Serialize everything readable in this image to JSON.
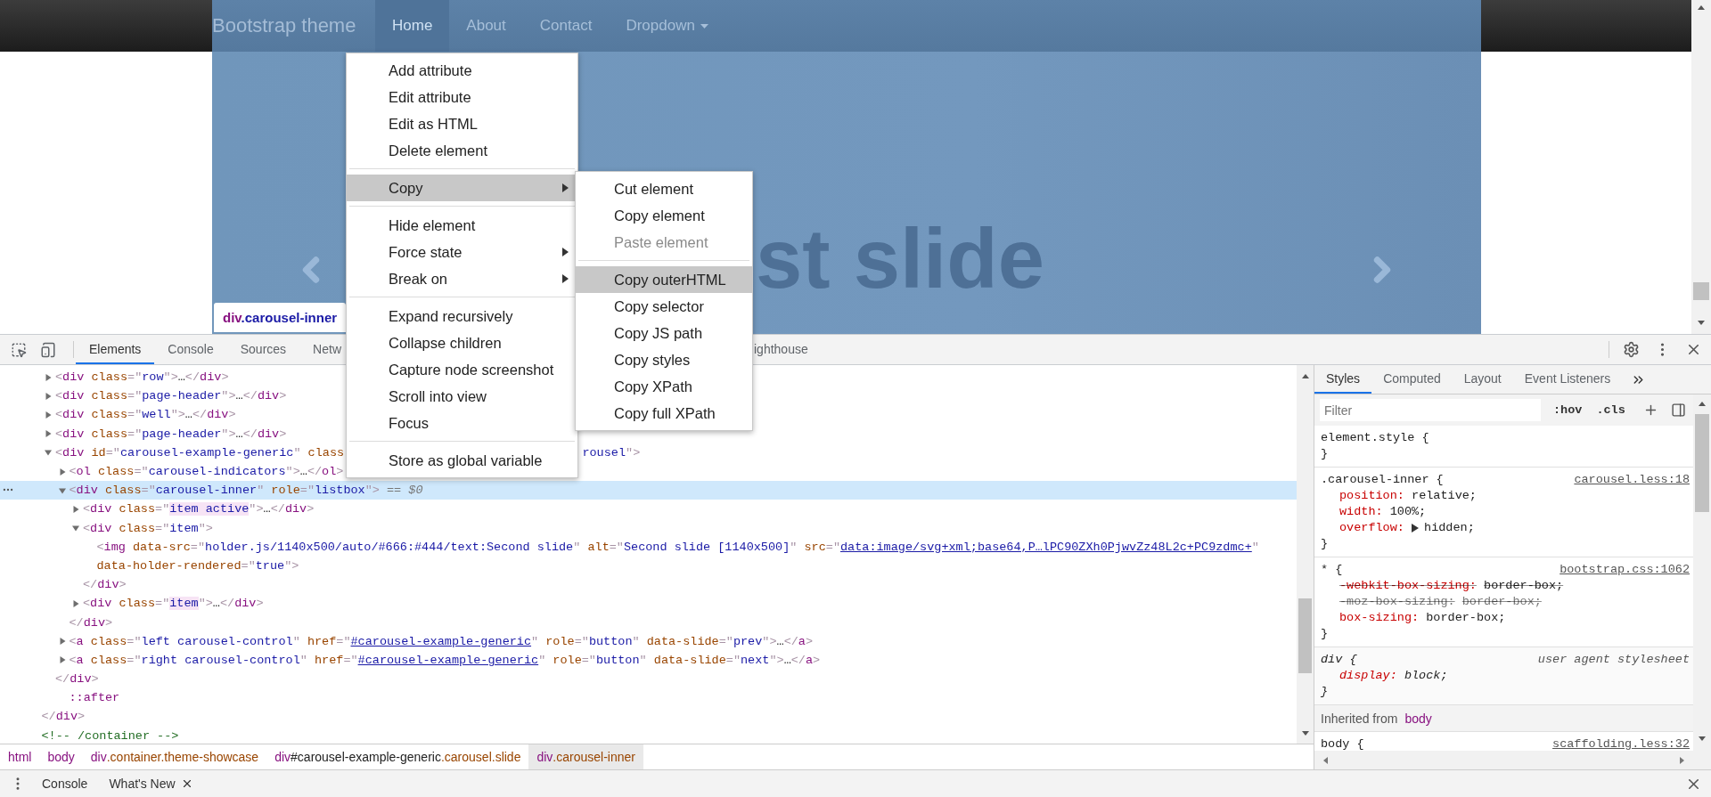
{
  "page": {
    "brand": "Bootstrap theme",
    "nav": [
      {
        "label": "Home",
        "selected": true,
        "dropdown": false
      },
      {
        "label": "About",
        "selected": false,
        "dropdown": false
      },
      {
        "label": "Contact",
        "selected": false,
        "dropdown": false
      },
      {
        "label": "Dropdown",
        "selected": false,
        "dropdown": true
      }
    ],
    "slide_caption": "st slide",
    "inspect_tooltip": {
      "tag": "div",
      "class_name": ".carousel-inner"
    }
  },
  "context_menu": {
    "groups": [
      [
        {
          "label": "Add attribute",
          "highlighted": false,
          "submenu": false,
          "disabled": false
        },
        {
          "label": "Edit attribute",
          "highlighted": false,
          "submenu": false,
          "disabled": false
        },
        {
          "label": "Edit as HTML",
          "highlighted": false,
          "submenu": false,
          "disabled": false
        },
        {
          "label": "Delete element",
          "highlighted": false,
          "submenu": false,
          "disabled": false
        }
      ],
      [
        {
          "label": "Copy",
          "highlighted": true,
          "submenu": true,
          "disabled": false
        }
      ],
      [
        {
          "label": "Hide element",
          "highlighted": false,
          "submenu": false,
          "disabled": false
        },
        {
          "label": "Force state",
          "highlighted": false,
          "submenu": true,
          "disabled": false
        },
        {
          "label": "Break on",
          "highlighted": false,
          "submenu": true,
          "disabled": false
        }
      ],
      [
        {
          "label": "Expand recursively",
          "highlighted": false,
          "submenu": false,
          "disabled": false
        },
        {
          "label": "Collapse children",
          "highlighted": false,
          "submenu": false,
          "disabled": false
        },
        {
          "label": "Capture node screenshot",
          "highlighted": false,
          "submenu": false,
          "disabled": false
        },
        {
          "label": "Scroll into view",
          "highlighted": false,
          "submenu": false,
          "disabled": false
        },
        {
          "label": "Focus",
          "highlighted": false,
          "submenu": false,
          "disabled": false
        }
      ],
      [
        {
          "label": "Store as global variable",
          "highlighted": false,
          "submenu": false,
          "disabled": false
        }
      ]
    ]
  },
  "submenu": {
    "groups": [
      [
        {
          "label": "Cut element",
          "highlighted": false,
          "submenu": false,
          "disabled": false
        },
        {
          "label": "Copy element",
          "highlighted": false,
          "submenu": false,
          "disabled": false
        },
        {
          "label": "Paste element",
          "highlighted": false,
          "submenu": false,
          "disabled": true
        }
      ],
      [
        {
          "label": "Copy outerHTML",
          "highlighted": true,
          "submenu": false,
          "disabled": false
        },
        {
          "label": "Copy selector",
          "highlighted": false,
          "submenu": false,
          "disabled": false
        },
        {
          "label": "Copy JS path",
          "highlighted": false,
          "submenu": false,
          "disabled": false
        },
        {
          "label": "Copy styles",
          "highlighted": false,
          "submenu": false,
          "disabled": false
        },
        {
          "label": "Copy XPath",
          "highlighted": false,
          "submenu": false,
          "disabled": false
        },
        {
          "label": "Copy full XPath",
          "highlighted": false,
          "submenu": false,
          "disabled": false
        }
      ]
    ]
  },
  "devtools": {
    "tabs": [
      {
        "label": "Elements",
        "selected": true
      },
      {
        "label": "Console",
        "selected": false
      },
      {
        "label": "Sources",
        "selected": false
      },
      {
        "label": "Netw",
        "selected": false
      },
      {
        "label": "ighthouse",
        "selected": false
      }
    ],
    "dom_tree": [
      {
        "kind": "expandable",
        "expanded": false,
        "selected": false,
        "tokens": [
          {
            "kind": "p",
            "text": "<"
          },
          {
            "kind": "tag",
            "text": "div"
          },
          {
            "kind": "attr",
            "text": " class"
          },
          {
            "kind": "p",
            "text": "=\""
          },
          {
            "kind": "val",
            "text": "row"
          },
          {
            "kind": "p",
            "text": "\">"
          },
          {
            "kind": "text",
            "text": "…"
          },
          {
            "kind": "p",
            "text": "</"
          },
          {
            "kind": "tag",
            "text": "div"
          },
          {
            "kind": "p",
            "text": ">"
          }
        ]
      },
      {
        "kind": "expandable",
        "expanded": false,
        "selected": false,
        "tokens": [
          {
            "kind": "p",
            "text": "<"
          },
          {
            "kind": "tag",
            "text": "div"
          },
          {
            "kind": "attr",
            "text": " class"
          },
          {
            "kind": "p",
            "text": "=\""
          },
          {
            "kind": "val",
            "text": "page-header"
          },
          {
            "kind": "p",
            "text": "\">"
          },
          {
            "kind": "text",
            "text": "…"
          },
          {
            "kind": "p",
            "text": "</"
          },
          {
            "kind": "tag",
            "text": "div"
          },
          {
            "kind": "p",
            "text": ">"
          }
        ]
      },
      {
        "kind": "expandable",
        "expanded": false,
        "selected": false,
        "tokens": [
          {
            "kind": "p",
            "text": "<"
          },
          {
            "kind": "tag",
            "text": "div"
          },
          {
            "kind": "attr",
            "text": " class"
          },
          {
            "kind": "p",
            "text": "=\""
          },
          {
            "kind": "val",
            "text": "well"
          },
          {
            "kind": "p",
            "text": "\">"
          },
          {
            "kind": "text",
            "text": "…"
          },
          {
            "kind": "p",
            "text": "</"
          },
          {
            "kind": "tag",
            "text": "div"
          },
          {
            "kind": "p",
            "text": ">"
          }
        ]
      },
      {
        "kind": "expandable",
        "expanded": false,
        "selected": false,
        "tokens": [
          {
            "kind": "p",
            "text": "<"
          },
          {
            "kind": "tag",
            "text": "div"
          },
          {
            "kind": "attr",
            "text": " class"
          },
          {
            "kind": "p",
            "text": "=\""
          },
          {
            "kind": "val",
            "text": "page-header"
          },
          {
            "kind": "p",
            "text": "\">"
          },
          {
            "kind": "text",
            "text": "…"
          },
          {
            "kind": "p",
            "text": "</"
          },
          {
            "kind": "tag",
            "text": "div"
          },
          {
            "kind": "p",
            "text": ">"
          }
        ]
      },
      {
        "kind": "expandable",
        "expanded": true,
        "selected": false,
        "tokens": [
          {
            "kind": "p",
            "text": "<"
          },
          {
            "kind": "tag",
            "text": "div"
          },
          {
            "kind": "attr",
            "text": " id"
          },
          {
            "kind": "p",
            "text": "=\""
          },
          {
            "kind": "val",
            "text": "carousel-example-generic"
          },
          {
            "kind": "p",
            "text": "\""
          },
          {
            "kind": "attr",
            "text": " class"
          }
        ],
        "tokens_past_menu": [
          {
            "kind": "val",
            "text": "rousel"
          },
          {
            "kind": "p",
            "text": "\">"
          }
        ],
        "close": [
          {
            "kind": "p",
            "text": "</"
          },
          {
            "kind": "tag",
            "text": "div"
          },
          {
            "kind": "p",
            "text": ">"
          }
        ],
        "children": [
          {
            "kind": "expandable",
            "expanded": false,
            "selected": false,
            "tokens": [
              {
                "kind": "p",
                "text": "<"
              },
              {
                "kind": "tag",
                "text": "ol"
              },
              {
                "kind": "attr",
                "text": " class"
              },
              {
                "kind": "p",
                "text": "=\""
              },
              {
                "kind": "val",
                "text": "carousel-indicators"
              },
              {
                "kind": "p",
                "text": "\">"
              },
              {
                "kind": "text",
                "text": "…"
              },
              {
                "kind": "p",
                "text": "</"
              },
              {
                "kind": "tag",
                "text": "ol"
              },
              {
                "kind": "p",
                "text": ">"
              }
            ]
          },
          {
            "kind": "expandable",
            "expanded": true,
            "selected": true,
            "tokens": [
              {
                "kind": "p",
                "text": "<"
              },
              {
                "kind": "tag",
                "text": "div"
              },
              {
                "kind": "attr",
                "text": " class"
              },
              {
                "kind": "p",
                "text": "=\""
              },
              {
                "kind": "val",
                "text": "carousel-inner"
              },
              {
                "kind": "p",
                "text": "\""
              },
              {
                "kind": "attr",
                "text": " role"
              },
              {
                "kind": "p",
                "text": "=\""
              },
              {
                "kind": "val",
                "text": "listbox"
              },
              {
                "kind": "p",
                "text": "\">"
              },
              {
                "kind": "marker",
                "text": " == $0"
              }
            ],
            "close": [
              {
                "kind": "p",
                "text": "</"
              },
              {
                "kind": "tag",
                "text": "div"
              },
              {
                "kind": "p",
                "text": ">"
              }
            ],
            "children": [
              {
                "kind": "expandable",
                "expanded": false,
                "selected": false,
                "tokens": [
                  {
                    "kind": "p",
                    "text": "<"
                  },
                  {
                    "kind": "tag",
                    "text": "div"
                  },
                  {
                    "kind": "attr",
                    "text": " class"
                  },
                  {
                    "kind": "p",
                    "text": "=\""
                  },
                  {
                    "kind": "flash",
                    "text": "item active"
                  },
                  {
                    "kind": "p",
                    "text": "\">"
                  },
                  {
                    "kind": "text",
                    "text": "…"
                  },
                  {
                    "kind": "p",
                    "text": "</"
                  },
                  {
                    "kind": "tag",
                    "text": "div"
                  },
                  {
                    "kind": "p",
                    "text": ">"
                  }
                ]
              },
              {
                "kind": "expandable",
                "expanded": true,
                "selected": false,
                "tokens": [
                  {
                    "kind": "p",
                    "text": "<"
                  },
                  {
                    "kind": "tag",
                    "text": "div"
                  },
                  {
                    "kind": "attr",
                    "text": " class"
                  },
                  {
                    "kind": "p",
                    "text": "=\""
                  },
                  {
                    "kind": "val",
                    "text": "item"
                  },
                  {
                    "kind": "p",
                    "text": "\">"
                  }
                ],
                "close": [
                  {
                    "kind": "p",
                    "text": "</"
                  },
                  {
                    "kind": "tag",
                    "text": "div"
                  },
                  {
                    "kind": "p",
                    "text": ">"
                  }
                ],
                "children": [
                  {
                    "kind": "leaf",
                    "selected": false,
                    "tokens": [
                      {
                        "kind": "p",
                        "text": "<"
                      },
                      {
                        "kind": "tag",
                        "text": "img"
                      },
                      {
                        "kind": "attr",
                        "text": " data-src"
                      },
                      {
                        "kind": "p",
                        "text": "=\""
                      },
                      {
                        "kind": "val",
                        "text": "holder.js/1140x500/auto/#666:#444/text:Second slide"
                      },
                      {
                        "kind": "p",
                        "text": "\""
                      },
                      {
                        "kind": "attr",
                        "text": " alt"
                      },
                      {
                        "kind": "p",
                        "text": "=\""
                      },
                      {
                        "kind": "val",
                        "text": "Second slide [1140x500]"
                      },
                      {
                        "kind": "p",
                        "text": "\""
                      },
                      {
                        "kind": "attr",
                        "text": " src"
                      },
                      {
                        "kind": "p",
                        "text": "=\""
                      },
                      {
                        "kind": "link",
                        "text": "data:image/svg+xml;base64,P…lPC90ZXh0PjwvZz48L2c+PC9zdmc+"
                      },
                      {
                        "kind": "p",
                        "text": "\""
                      }
                    ],
                    "wrapped": [
                      {
                        "kind": "attr",
                        "text": "data-holder-rendered"
                      },
                      {
                        "kind": "p",
                        "text": "=\""
                      },
                      {
                        "kind": "val",
                        "text": "true"
                      },
                      {
                        "kind": "p",
                        "text": "\">"
                      }
                    ]
                  }
                ]
              },
              {
                "kind": "expandable",
                "expanded": false,
                "selected": false,
                "tokens": [
                  {
                    "kind": "p",
                    "text": "<"
                  },
                  {
                    "kind": "tag",
                    "text": "div"
                  },
                  {
                    "kind": "attr",
                    "text": " class"
                  },
                  {
                    "kind": "p",
                    "text": "=\""
                  },
                  {
                    "kind": "flash",
                    "text": "item"
                  },
                  {
                    "kind": "p",
                    "text": "\">"
                  },
                  {
                    "kind": "text",
                    "text": "…"
                  },
                  {
                    "kind": "p",
                    "text": "</"
                  },
                  {
                    "kind": "tag",
                    "text": "div"
                  },
                  {
                    "kind": "p",
                    "text": ">"
                  }
                ]
              }
            ]
          },
          {
            "kind": "expandable",
            "expanded": false,
            "selected": false,
            "tokens": [
              {
                "kind": "p",
                "text": "<"
              },
              {
                "kind": "tag",
                "text": "a"
              },
              {
                "kind": "attr",
                "text": " class"
              },
              {
                "kind": "p",
                "text": "=\""
              },
              {
                "kind": "val",
                "text": "left carousel-control"
              },
              {
                "kind": "p",
                "text": "\""
              },
              {
                "kind": "attr",
                "text": " href"
              },
              {
                "kind": "p",
                "text": "=\""
              },
              {
                "kind": "link",
                "text": "#carousel-example-generic"
              },
              {
                "kind": "p",
                "text": "\""
              },
              {
                "kind": "attr",
                "text": " role"
              },
              {
                "kind": "p",
                "text": "=\""
              },
              {
                "kind": "val",
                "text": "button"
              },
              {
                "kind": "p",
                "text": "\""
              },
              {
                "kind": "attr",
                "text": " data-slide"
              },
              {
                "kind": "p",
                "text": "=\""
              },
              {
                "kind": "val",
                "text": "prev"
              },
              {
                "kind": "p",
                "text": "\">"
              },
              {
                "kind": "text",
                "text": "…"
              },
              {
                "kind": "p",
                "text": "</"
              },
              {
                "kind": "tag",
                "text": "a"
              },
              {
                "kind": "p",
                "text": ">"
              }
            ]
          },
          {
            "kind": "expandable",
            "expanded": false,
            "selected": false,
            "tokens": [
              {
                "kind": "p",
                "text": "<"
              },
              {
                "kind": "tag",
                "text": "a"
              },
              {
                "kind": "attr",
                "text": " class"
              },
              {
                "kind": "p",
                "text": "=\""
              },
              {
                "kind": "val",
                "text": "right carousel-control"
              },
              {
                "kind": "p",
                "text": "\""
              },
              {
                "kind": "attr",
                "text": " href"
              },
              {
                "kind": "p",
                "text": "=\""
              },
              {
                "kind": "link",
                "text": "#carousel-example-generic"
              },
              {
                "kind": "p",
                "text": "\""
              },
              {
                "kind": "attr",
                "text": " role"
              },
              {
                "kind": "p",
                "text": "=\""
              },
              {
                "kind": "val",
                "text": "button"
              },
              {
                "kind": "p",
                "text": "\""
              },
              {
                "kind": "attr",
                "text": " data-slide"
              },
              {
                "kind": "p",
                "text": "=\""
              },
              {
                "kind": "val",
                "text": "next"
              },
              {
                "kind": "p",
                "text": "\">"
              },
              {
                "kind": "text",
                "text": "…"
              },
              {
                "kind": "p",
                "text": "</"
              },
              {
                "kind": "tag",
                "text": "a"
              },
              {
                "kind": "p",
                "text": ">"
              }
            ]
          }
        ]
      },
      {
        "kind": "pseudo",
        "selected": false,
        "tokens": [
          {
            "kind": "pseudo",
            "text": "::after"
          }
        ]
      }
    ],
    "container_close": [
      {
        "kind": "p",
        "text": "</"
      },
      {
        "kind": "tag",
        "text": "div"
      },
      {
        "kind": "p",
        "text": ">"
      }
    ],
    "comment": "<!-- /container -->",
    "breadcrumbs": [
      {
        "parts": [
          {
            "kind": "tag",
            "text": "html"
          }
        ],
        "selected": false
      },
      {
        "parts": [
          {
            "kind": "tag",
            "text": "body"
          }
        ],
        "selected": false
      },
      {
        "parts": [
          {
            "kind": "tag",
            "text": "div"
          },
          {
            "kind": "cls",
            "text": ".container.theme-showcase"
          }
        ],
        "selected": false
      },
      {
        "parts": [
          {
            "kind": "tag",
            "text": "div"
          },
          {
            "kind": "id",
            "text": "#carousel-example-generic"
          },
          {
            "kind": "cls",
            "text": ".carousel.slide"
          }
        ],
        "selected": false
      },
      {
        "parts": [
          {
            "kind": "tag",
            "text": "div"
          },
          {
            "kind": "cls",
            "text": ".carousel-inner"
          }
        ],
        "selected": true
      }
    ],
    "styles_tabs": [
      {
        "label": "Styles",
        "selected": true
      },
      {
        "label": "Computed",
        "selected": false
      },
      {
        "label": "Layout",
        "selected": false
      },
      {
        "label": "Event Listeners",
        "selected": false
      }
    ],
    "filter": {
      "placeholder": "Filter"
    },
    "hov": ":hov",
    "cls": ".cls",
    "rules": [
      {
        "kind": "inline",
        "selector": "element.style {",
        "close": "}"
      },
      {
        "kind": "author",
        "selector": ".carousel-inner {",
        "source": "carousel.less:18",
        "close": "}",
        "properties": [
          {
            "name": "position:",
            "value": "relative;",
            "overridden": false,
            "invalid": false,
            "expandable": false
          },
          {
            "name": "width:",
            "value": "100%;",
            "overridden": false,
            "invalid": false,
            "expandable": false
          },
          {
            "name": "overflow:",
            "value": "hidden;",
            "overridden": false,
            "invalid": false,
            "expandable": true
          }
        ]
      },
      {
        "kind": "author",
        "selector": "* {",
        "source": "bootstrap.css:1062",
        "close": "}",
        "properties": [
          {
            "name": "-webkit-box-sizing:",
            "value": "border-box;",
            "overridden": true,
            "invalid": false,
            "expandable": false
          },
          {
            "name": "-moz-box-sizing:",
            "value": "border-box;",
            "overridden": true,
            "invalid": true,
            "expandable": false
          },
          {
            "name": "box-sizing:",
            "value": "border-box;",
            "overridden": false,
            "invalid": false,
            "expandable": false
          }
        ]
      },
      {
        "kind": "user_agent",
        "selector": "div {",
        "source": "user agent stylesheet",
        "close": "}",
        "properties": [
          {
            "name": "display:",
            "value": "block;",
            "overridden": false,
            "invalid": false,
            "expandable": false
          }
        ]
      }
    ],
    "inherited": {
      "label": "Inherited from",
      "source": "body",
      "rules": [
        {
          "kind": "author",
          "selector": "body {",
          "source": "scaffolding.less:32"
        }
      ]
    },
    "drawer": {
      "tabs": [
        {
          "label": "Console",
          "closable": false
        },
        {
          "label": "What's New",
          "closable": true
        }
      ]
    }
  }
}
